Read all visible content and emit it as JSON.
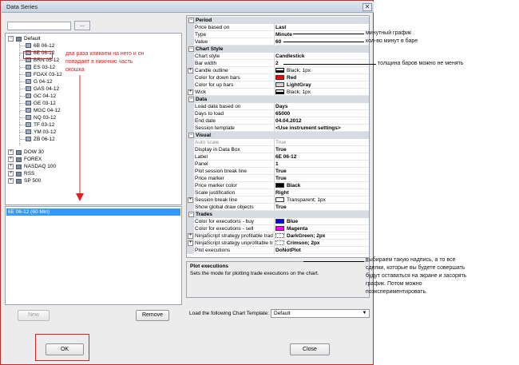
{
  "window": {
    "title": "Data Series",
    "close_glyph": "✕"
  },
  "search": {
    "value": "",
    "button_label": "..."
  },
  "tree": {
    "root": "Default",
    "default_children": [
      "6B 06-12",
      "6E 06-12",
      "BRN 05-12",
      "ES 03-12",
      "FDAX 03-12",
      "G 04-12",
      "GAS 04-12",
      "GC 04-12",
      "GE 03-12",
      "MGC 04-12",
      "NQ 03-12",
      "TF 03-12",
      "YM 03-12",
      "ZB 06-12"
    ],
    "groups": [
      "DOW 30",
      "FOREX",
      "NASDAQ 100",
      "RSS",
      "SP 500"
    ]
  },
  "selected_series": "6E 06-12 (60 Min)",
  "buttons": {
    "new": "New",
    "remove": "Remove",
    "ok": "OK",
    "close": "Close"
  },
  "property_grid": {
    "period": {
      "category": "Period",
      "rows": [
        {
          "name": "Price based on",
          "value": "Last"
        },
        {
          "name": "Type",
          "value": "Minute"
        },
        {
          "name": "Value",
          "value": "60"
        }
      ]
    },
    "chart_style": {
      "category": "Chart Style",
      "rows": [
        {
          "name": "Chart style",
          "value": "Candlestick"
        },
        {
          "name": "Bar width",
          "value": "2"
        },
        {
          "name": "Candle outline",
          "value": "Black; 1px"
        },
        {
          "name": "Color for down bars",
          "value": "Red"
        },
        {
          "name": "Color for up bars",
          "value": "LightGray"
        },
        {
          "name": "Wick",
          "value": "Black; 1px"
        }
      ]
    },
    "data": {
      "category": "Data",
      "rows": [
        {
          "name": "Load data based on",
          "value": "Days"
        },
        {
          "name": "Days to load",
          "value": "65000"
        },
        {
          "name": "End date",
          "value": "04.04.2012"
        },
        {
          "name": "Session template",
          "value": "<Use instrument settings>"
        }
      ]
    },
    "visual": {
      "category": "Visual",
      "rows": [
        {
          "name": "Auto scale",
          "value": "True"
        },
        {
          "name": "Display in Data Box",
          "value": "True"
        },
        {
          "name": "Label",
          "value": "6E 06-12"
        },
        {
          "name": "Panel",
          "value": "1"
        },
        {
          "name": "Plot session break line",
          "value": "True"
        },
        {
          "name": "Price marker",
          "value": "True"
        },
        {
          "name": "Price marker color",
          "value": "Black"
        },
        {
          "name": "Scale justification",
          "value": "Right"
        },
        {
          "name": "Session break line",
          "value": "Transparent; 1px"
        },
        {
          "name": "Show global draw objects",
          "value": "True"
        }
      ]
    },
    "trades": {
      "category": "Trades",
      "rows": [
        {
          "name": "Color for executions - buy",
          "value": "Blue"
        },
        {
          "name": "Color for executions - sell",
          "value": "Magenta"
        },
        {
          "name": "NinjaScript strategy profitable trad",
          "value": "DarkGreen; 2px"
        },
        {
          "name": "NinjaScript strategy unprofitable tr",
          "value": "Crimson; 2px"
        },
        {
          "name": "Plot executions",
          "value": "DoNotPlot"
        }
      ]
    }
  },
  "colors": {
    "red": "#ff0000",
    "lightgray": "#d3d3d3",
    "black": "#000000",
    "blue": "#0000ff",
    "magenta": "#ff00ff",
    "darkgreen": "#006400",
    "crimson": "#dc143c",
    "accent": "#3399ff"
  },
  "description": {
    "title": "Plot executions",
    "text": "Sets the mode for plotting trade executions on the chart."
  },
  "template": {
    "label": "Load the following Chart Template:",
    "value": "Default"
  },
  "annotations": {
    "red_note_line1": "два раза кликаем на него и он",
    "red_note_line2": "попадает в нижнюю часть",
    "red_note_line3": "окошка",
    "minute_chart": "минутный график",
    "minutes_per_bar": "кол-во минут в баре",
    "bar_width_note": "толщина баров можно не менять",
    "exec_note_1": "выбираем такую надпись, а то все",
    "exec_note_2": "сделки, которые вы будете совершать",
    "exec_note_3": "будут оставаться на экране и засорять",
    "exec_note_4": "график. Потом можно",
    "exec_note_5": "поэкспериментировать."
  }
}
